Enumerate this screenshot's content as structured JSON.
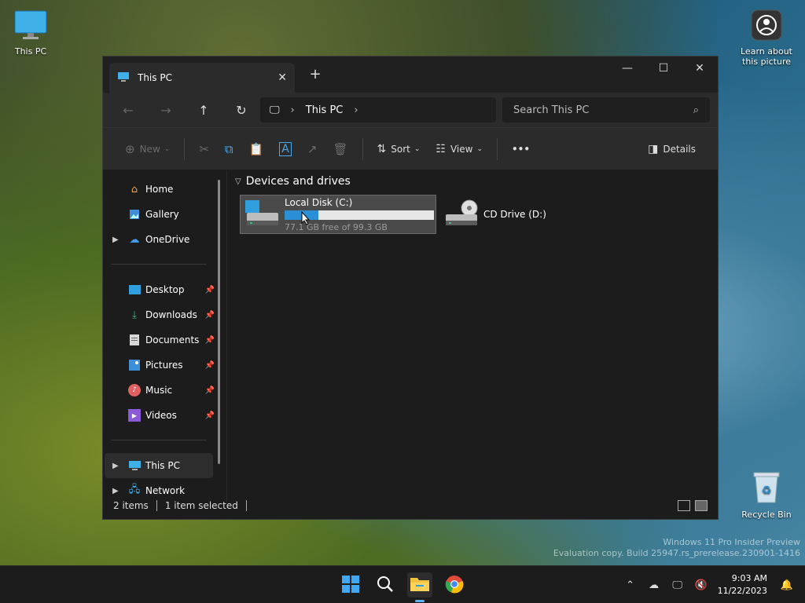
{
  "desktop": {
    "this_pc_label": "This PC",
    "learn_label": "Learn about this picture",
    "recycle_label": "Recycle Bin",
    "watermark_line1": "Windows 11 Pro Insider Preview",
    "watermark_line2": "Evaluation copy. Build 25947.rs_prerelease.230901-1416"
  },
  "window": {
    "tab_title": "This PC",
    "tab_close": "✕",
    "new_tab": "+",
    "minimize": "—",
    "maximize": "☐",
    "close": "✕"
  },
  "nav": {
    "back": "←",
    "forward": "→",
    "up": "↑",
    "refresh": "↻",
    "address_icon": "🖵",
    "address_chevron": "›",
    "address_path": "This PC",
    "address_end_chevron": "›",
    "search_placeholder": "Search This PC",
    "search_icon": "⌕"
  },
  "toolbar": {
    "new_label": "New",
    "sort_label": "Sort",
    "view_label": "View",
    "more_label": "•••",
    "details_label": "Details"
  },
  "sidebar": {
    "home": "Home",
    "gallery": "Gallery",
    "onedrive": "OneDrive",
    "desktop": "Desktop",
    "downloads": "Downloads",
    "documents": "Documents",
    "pictures": "Pictures",
    "music": "Music",
    "videos": "Videos",
    "this_pc": "This PC",
    "network": "Network"
  },
  "content": {
    "group_title": "Devices and drives",
    "drives": [
      {
        "name": "Local Disk (C:)",
        "free_text": "77.1 GB free of 99.3 GB",
        "used_fraction": 0.224
      },
      {
        "name": "CD Drive (D:)"
      }
    ]
  },
  "status": {
    "items": "2 items",
    "selected": "1 item selected"
  },
  "taskbar": {
    "time": "9:03 AM",
    "date": "11/22/2023"
  },
  "colors": {
    "accent": "#2b8fd6",
    "window_bg": "#1c1c1c"
  }
}
